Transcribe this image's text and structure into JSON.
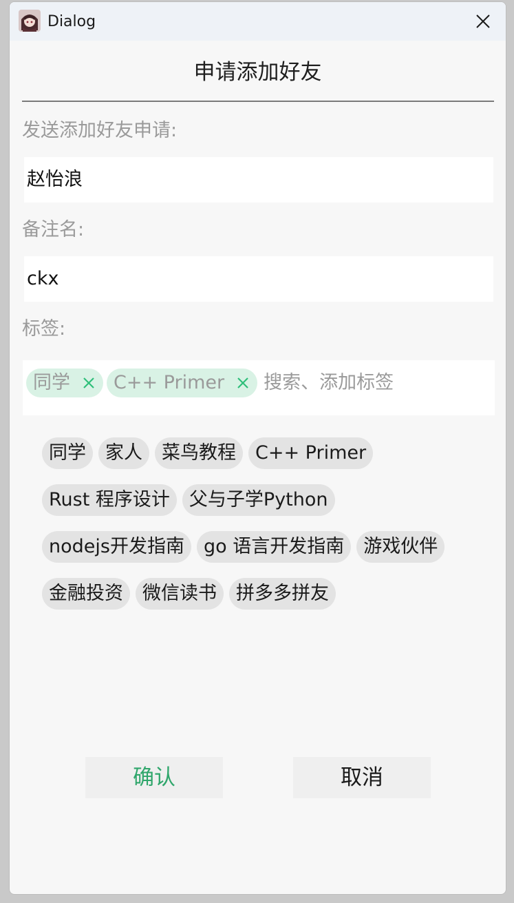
{
  "window": {
    "title": "Dialog"
  },
  "dialog": {
    "heading": "申请添加好友"
  },
  "form": {
    "send_request_label": "发送添加好友申请:",
    "send_request_value": "赵怡浪",
    "remark_label": "备注名:",
    "remark_value": "ckx",
    "tags_label": "标签:",
    "tag_search_placeholder": "搜索、添加标签"
  },
  "selected_tags": [
    "同学",
    "C++ Primer"
  ],
  "available_tags": [
    [
      "同学",
      "家人",
      "菜鸟教程",
      "C++ Primer"
    ],
    [
      "Rust 程序设计",
      "父与子学Python"
    ],
    [
      "nodejs开发指南",
      "go 语言开发指南",
      "游戏伙伴"
    ],
    [
      "金融投资",
      "微信读书",
      "拼多多拼友"
    ]
  ],
  "buttons": {
    "confirm": "确认",
    "cancel": "取消"
  },
  "colors": {
    "accent_green": "#2fa66b",
    "selected_tag_bg": "#d9f2e5",
    "chip_bg": "#e3e3e3"
  }
}
